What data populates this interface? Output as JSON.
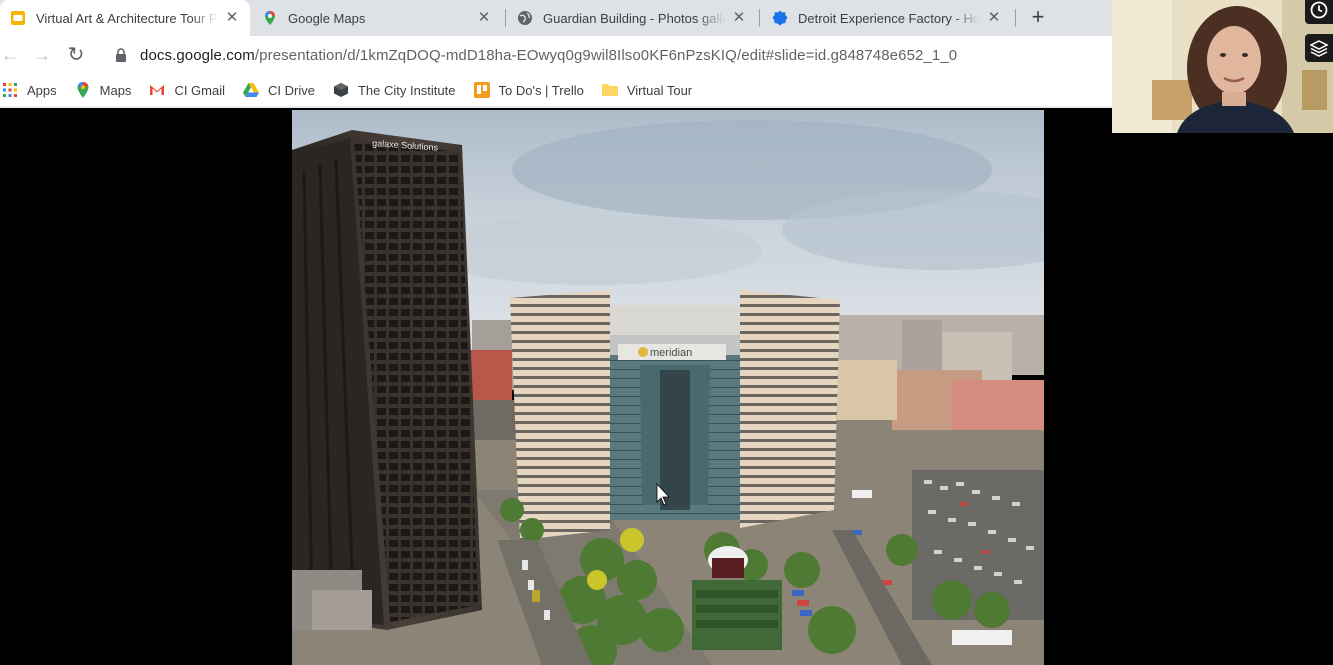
{
  "browser": {
    "tabs": [
      {
        "title": "Virtual Art & Architecture Tour P",
        "active": true,
        "icon": "google-slides-icon"
      },
      {
        "title": "Google Maps",
        "active": false,
        "icon": "google-maps-icon"
      },
      {
        "title": "Guardian Building - Photos galle",
        "active": false,
        "icon": "globe-icon"
      },
      {
        "title": "Detroit Experience Factory - How",
        "active": false,
        "icon": "puzzle-badge-icon"
      }
    ],
    "new_tab_label": "+",
    "close_glyph": "✕",
    "address": {
      "domain": "docs.google.com",
      "path": "/presentation/d/1kmZqDOQ-mdD18ha-EOwyq0g9wil8Ilso0KF6nPzsKIQ/edit#slide=id.g848748e652_1_0"
    },
    "nav": {
      "back": "←",
      "forward": "→",
      "reload": "↻"
    },
    "bookmarks": [
      {
        "label": "Apps",
        "icon": "apps-grid-icon"
      },
      {
        "label": "Maps",
        "icon": "maps-pin-icon"
      },
      {
        "label": "CI Gmail",
        "icon": "gmail-icon"
      },
      {
        "label": "CI Drive",
        "icon": "drive-icon"
      },
      {
        "label": "The City Institute",
        "icon": "cube-icon"
      },
      {
        "label": "To Do's | Trello",
        "icon": "trello-icon"
      },
      {
        "label": "Virtual Tour",
        "icon": "folder-icon"
      }
    ]
  },
  "slide": {
    "signs": {
      "tower": "galaxe Solutions",
      "center": "meridian"
    }
  },
  "colors": {
    "tabstrip": "#dee1e6",
    "accent_blue": "#1a73e8"
  }
}
